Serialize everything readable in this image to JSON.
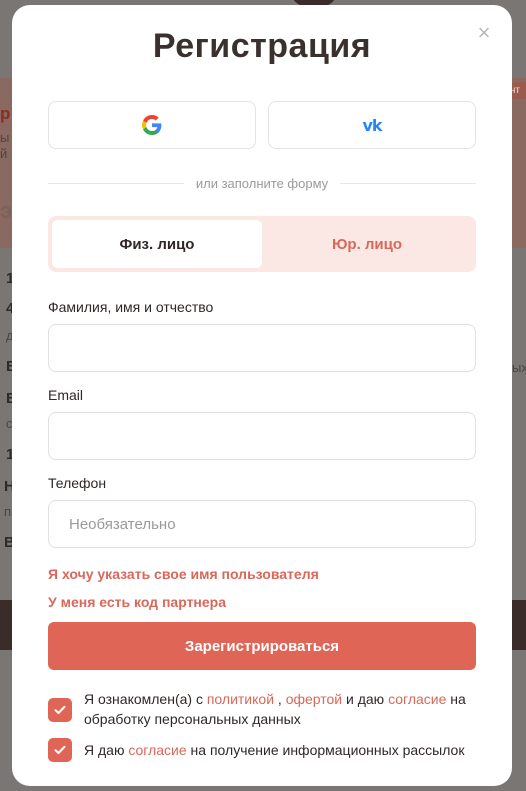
{
  "background": {
    "fragments": [
      "1",
      "4",
      "д",
      "В",
      "В",
      "с",
      "1",
      "Н",
      "п",
      "В",
      "ых",
      "р",
      "ы",
      "й",
      "э"
    ],
    "tag": "ент"
  },
  "modal": {
    "title": "Регистрация",
    "close": "×",
    "social": {
      "google_icon": "google-icon",
      "vk_icon_text": "vk"
    },
    "divider_text": "или заполните форму",
    "tabs": {
      "individual": "Физ. лицо",
      "legal": "Юр. лицо"
    },
    "fields": {
      "name_label": "Фамилия, имя и отчество",
      "name_value": "",
      "email_label": "Email",
      "email_value": "",
      "phone_label": "Телефон",
      "phone_placeholder": "Необязательно"
    },
    "links": {
      "username": "Я хочу указать свое имя пользователя",
      "partner_code": "У меня есть код партнера"
    },
    "submit_label": "Зарегистрироваться",
    "consent1": {
      "prefix": "Я ознакомлен(а) с ",
      "policy": "политикой",
      "sep": " , ",
      "offer": "офертой",
      "mid": " и даю ",
      "consent": "согласие",
      "suffix": " на обработку персональных данных"
    },
    "consent2": {
      "prefix": "Я даю ",
      "consent": "согласие",
      "suffix": " на получение информационных рассылок"
    }
  },
  "colors": {
    "accent": "#df6556",
    "accent_text": "#d9675a",
    "tab_bg": "#fbe8e5"
  }
}
